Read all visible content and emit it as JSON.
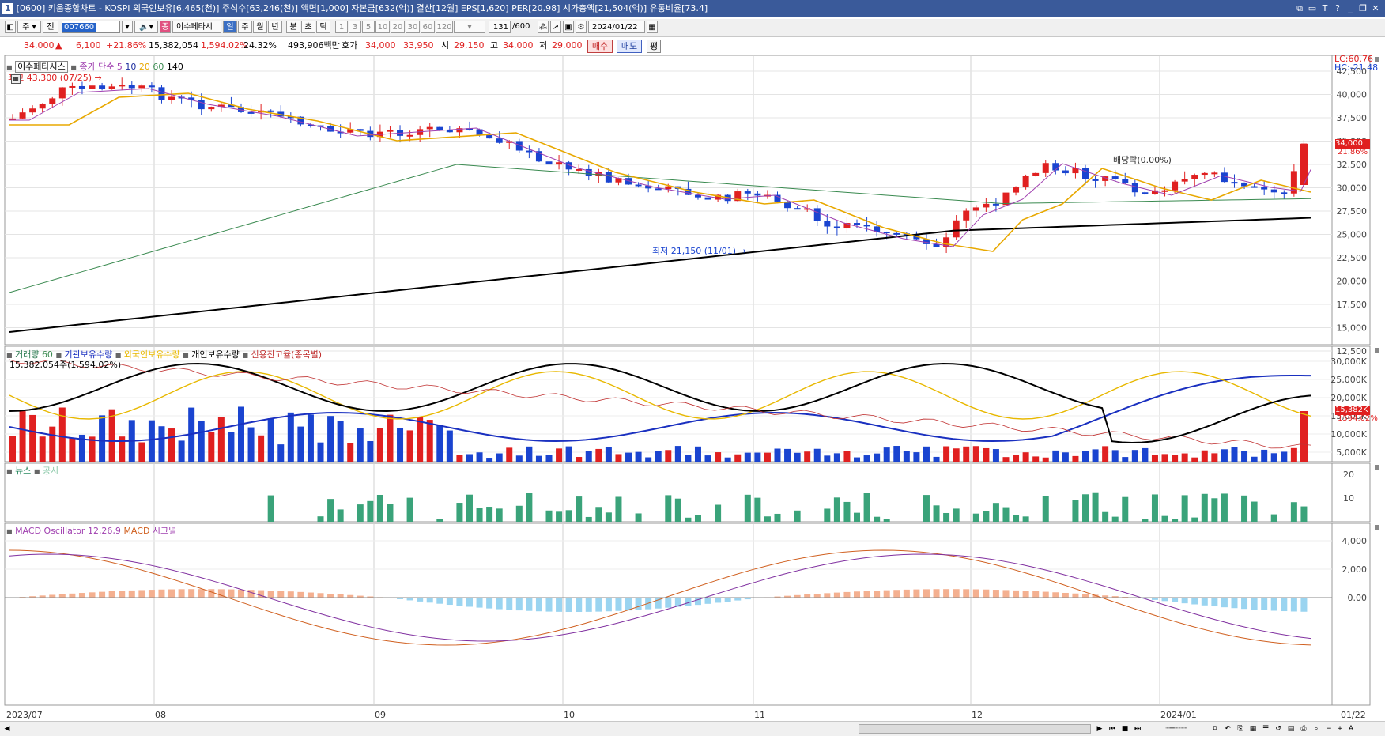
{
  "titlebar": {
    "window_num": "1",
    "title": "[0600] 키움종합차트 - KOSPI 외국인보유[6,465(천)] 주식수[63,246(천)] 액면[1,000] 자본금[632(억)] 결산[12월] EPS[1,620] PER[20.98] 시가총액[21,504(억)] 유통비율[73.4]"
  },
  "toolbar": {
    "period_label": "주",
    "all_label": "전",
    "stock_code": "007660",
    "stock_name": "이수페타시",
    "periods": [
      "일",
      "주",
      "월",
      "년",
      "분",
      "초",
      "틱"
    ],
    "minute_options": [
      "1",
      "3",
      "5",
      "10",
      "20",
      "30",
      "60",
      "120"
    ],
    "count": "131",
    "count_total": "/600",
    "date": "2024/01/22"
  },
  "pricebar": {
    "price": "34,000",
    "change": "6,100",
    "change_pct": "+21.86%",
    "volume": "15,382,054",
    "volume_pct": "1,594.02%",
    "turnover": "24.32%",
    "amount": "493,906백만",
    "bid_label": "호가",
    "bid": "34,000",
    "ask": "33,950",
    "open_label": "시",
    "open": "29,150",
    "high_label": "고",
    "high": "34,000",
    "low_label": "저",
    "low": "29,000",
    "buy_label": "매수",
    "sell_label": "매도",
    "eq_label": "평"
  },
  "price_panel": {
    "legend_name": "이수페타시스",
    "legend_ma": "종가 단순",
    "ma_periods": [
      "5",
      "10",
      "20",
      "60",
      "140"
    ],
    "high_marker": "최고 43,300 (07/25) →",
    "low_marker": "최저 21,150 (11/01) →",
    "dividend": "배당락(0.00%)",
    "lc": "LC:60.76",
    "hc": "HC:-21.48",
    "current_price": "34,000",
    "current_pct": "21.86%",
    "y_ticks": [
      "42,500",
      "40,000",
      "37,500",
      "35,000",
      "32,500",
      "30,000",
      "27,500",
      "25,000",
      "22,500",
      "20,000",
      "17,500",
      "15,000",
      "12,500"
    ]
  },
  "volume_panel": {
    "legend": [
      "거래량",
      "60",
      "기관보유수량",
      "외국인보유수량",
      "개인보유수량",
      "신용잔고율(종목별)"
    ],
    "info": "15,382,054주(1,594.02%)",
    "current": "15,382K",
    "current_pct": "1594.02%",
    "y_ticks": [
      "30,000K",
      "25,000K",
      "20,000K",
      "15,000K",
      "10,000K",
      "5,000K"
    ]
  },
  "news_panel": {
    "legend": [
      "뉴스",
      "공시"
    ],
    "y_ticks": [
      "20",
      "10"
    ]
  },
  "macd_panel": {
    "legend": [
      "MACD Oscillator 12,26,9",
      "MACD",
      "시그널"
    ],
    "y_ticks": [
      "4,000",
      "2,000",
      "0.00"
    ]
  },
  "x_axis": {
    "labels": [
      "2023/07",
      "08",
      "09",
      "10",
      "11",
      "12",
      "2024/01"
    ],
    "corner": "01/22"
  },
  "colors": {
    "up": "#e02020",
    "down": "#1a44d0",
    "ma5": "#a040b0",
    "ma10": "#2030a0",
    "ma20": "#e8a800",
    "ma60": "#3a8a50",
    "ma140": "#000000",
    "news": "#3aa37a",
    "osc_pos": "#f4b090",
    "osc_neg": "#9ad4f0"
  }
}
